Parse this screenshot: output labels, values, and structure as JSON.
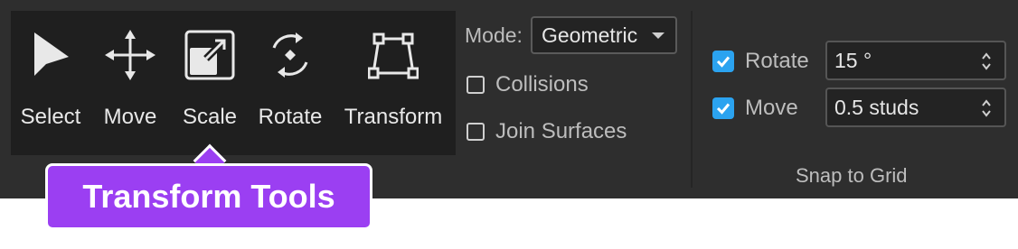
{
  "tools": [
    {
      "label": "Select",
      "icon": "cursor-arrow-icon"
    },
    {
      "label": "Move",
      "icon": "move-arrows-icon"
    },
    {
      "label": "Scale",
      "icon": "scale-icon"
    },
    {
      "label": "Rotate",
      "icon": "rotate-icon"
    },
    {
      "label": "Transform",
      "icon": "transform-icon"
    }
  ],
  "mode": {
    "label": "Mode:",
    "selected": "Geometric"
  },
  "options": {
    "collisions": "Collisions",
    "join_surfaces": "Join Surfaces"
  },
  "snap": {
    "rotate_label": "Rotate",
    "rotate_value": "15 °",
    "move_label": "Move",
    "move_value": "0.5 studs",
    "caption": "Snap to Grid"
  },
  "tooltip": {
    "text": "Transform Tools"
  },
  "colors": {
    "ribbon": "#2e2e2e",
    "panel": "#1f1f1f",
    "accent_check": "#2ba3f0",
    "tooltip": "#9b3ff2"
  }
}
